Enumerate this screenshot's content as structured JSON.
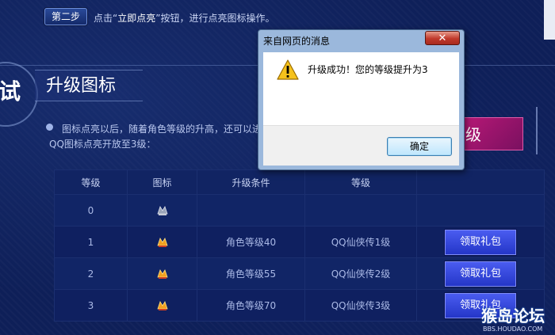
{
  "step": {
    "button_label": "第二步",
    "instruction_pre": "点击“",
    "instruction_action": "立即点亮",
    "instruction_post": "”按钮，进行点亮图标操作。"
  },
  "section": {
    "side_char": "试",
    "title": "升级图标",
    "desc_line1": "图标点亮以后，随着角色等级的升高，还可以进",
    "desc_line2": "QQ图标点亮开放至3级："
  },
  "upgrade_button_label": "级",
  "table": {
    "headers": [
      "等级",
      "图标",
      "升级条件",
      "等级",
      ""
    ],
    "rows": [
      {
        "level": "0",
        "condition": "",
        "qq_level": "",
        "has_gift": false
      },
      {
        "level": "1",
        "condition": "角色等级40",
        "qq_level": "QQ仙侠传1级",
        "has_gift": true
      },
      {
        "level": "2",
        "condition": "角色等级55",
        "qq_level": "QQ仙侠传2级",
        "has_gift": true
      },
      {
        "level": "3",
        "condition": "角色等级70",
        "qq_level": "QQ仙侠传3级",
        "has_gift": true
      }
    ],
    "gift_label": "领取礼包"
  },
  "dialog": {
    "title": "来自网页的消息",
    "close_label": "✕",
    "message": "升级成功！您的等级提升为3",
    "ok_label": "确定",
    "icon": "warning-icon"
  },
  "watermark": {
    "text": "猴岛论坛",
    "url": "BBS.HOUDAO.COM"
  },
  "colors": {
    "background": "#0e1f58",
    "gift_button": "#3446e0",
    "pink_button": "#b01872",
    "dialog_frame": "#9bb8dc"
  }
}
